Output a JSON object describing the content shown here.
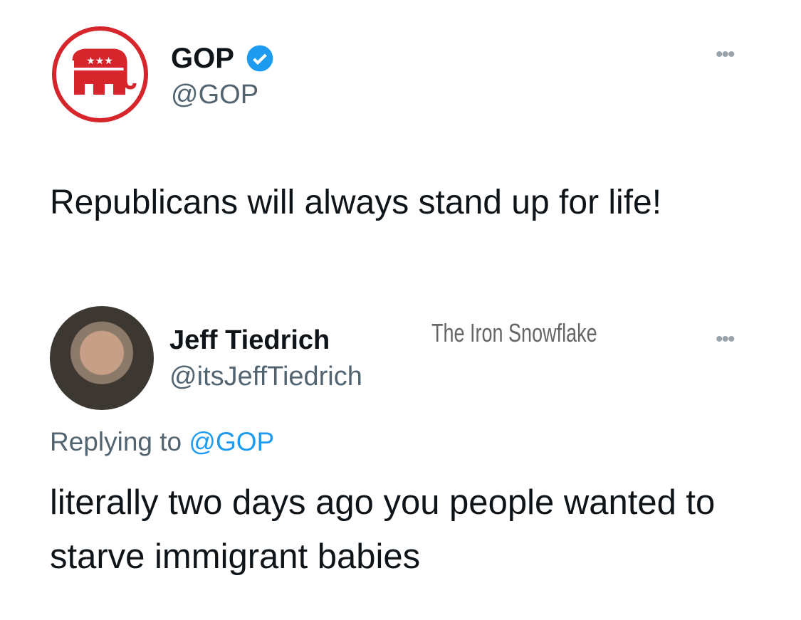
{
  "tweet": {
    "name": "GOP",
    "handle": "@GOP",
    "text": "Republicans will always stand up for life!",
    "more": "•••"
  },
  "reply": {
    "name": "Jeff Tiedrich",
    "handle": "@itsJeffTiedrich",
    "replying_prefix": "Replying to ",
    "replying_handle": "@GOP",
    "text": "literally two days ago you people wanted to starve immigrant babies",
    "more": "•••"
  },
  "watermark": "The Iron Snowflake",
  "colors": {
    "accent": "#1d9bf0",
    "gop_red": "#d6262c"
  }
}
